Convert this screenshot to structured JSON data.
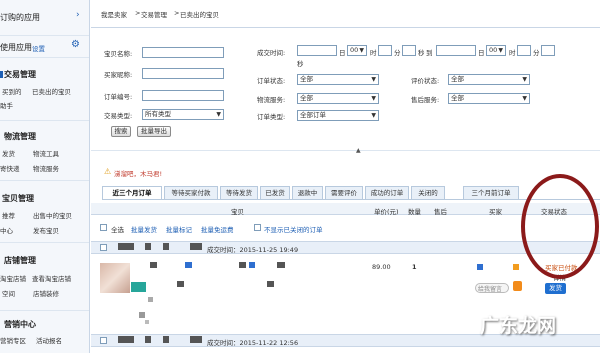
{
  "sidebar": {
    "top_link": "订购的应用",
    "my_apps": "使用应用",
    "settings": "设置",
    "sections": [
      {
        "title": "交易管理",
        "links": [
          "买到的",
          "已卖出的宝贝",
          "助手"
        ]
      },
      {
        "title": "物流管理",
        "links": [
          "发货",
          "物流工具",
          "寄快递",
          "物流服务"
        ]
      },
      {
        "title": "宝贝管理",
        "links": [
          "推荐",
          "出售中的宝贝",
          "中心",
          "发布宝贝"
        ]
      },
      {
        "title": "店铺管理",
        "links": [
          "淘宝店铺",
          "查看淘宝店铺",
          "空间",
          "店铺装修"
        ]
      },
      {
        "title": "营销中心",
        "links": [
          "营销专区",
          "活动报名"
        ]
      }
    ]
  },
  "breadcrumb": {
    "part1": "我是卖家",
    "sep": ">",
    "part2": "交易管理",
    "part3": "已卖出的宝贝"
  },
  "search_form": {
    "item_name_label": "宝贝名称:",
    "buyer_nick_label": "买家昵称:",
    "order_no_label": "订单编号:",
    "trade_type_label": "交易类型:",
    "trade_type_value": "所有类型",
    "deal_time_label": "成交时间:",
    "day": "日",
    "hour": "时",
    "minute": "分",
    "second": "秒",
    "to": "到",
    "hour_value": "00",
    "order_status_label": "订单状态:",
    "order_status_value": "全部",
    "logistics_label": "物流服务:",
    "logistics_value": "全部",
    "order_type_label": "订单类型:",
    "order_type_value": "全部订单",
    "review_status_label": "评价状态:",
    "review_status_value": "全部",
    "after_sale_label": "售后服务:",
    "after_sale_value": "全部",
    "search_button": "搜索",
    "export_button": "批量导出"
  },
  "notice": "涕溜吧，木马君!",
  "tabs": [
    "近三个月订单",
    "等待买家付款",
    "等待发货",
    "已发货",
    "退款中",
    "需要评价",
    "成功的订单",
    "关闭的",
    "三个月前订单"
  ],
  "table_header": {
    "item": "宝贝",
    "unit_price": "单价(元)",
    "quantity": "数量",
    "after_sale": "售后",
    "buyer": "买家",
    "status": "交易状态"
  },
  "bulk_actions": {
    "select_all": "全选",
    "batch_ship": "批量发货",
    "batch_mark": "批量标记",
    "batch_free_shipping": "批量免运费",
    "hide_closed": "不显示已关闭的订单"
  },
  "orders": [
    {
      "deal_time": "成交时间：2015-11-25 19:49",
      "price": "89.00",
      "quantity": "1",
      "status": "买家已付款",
      "detail": "详情",
      "ship_button": "发货",
      "memo_link": "给我留言"
    },
    {
      "deal_time": "成交时间：2015-11-22 12:56"
    }
  ],
  "watermark": "广东龙网",
  "colors": {
    "accent": "#1e5fb4",
    "circle": "#8b1a1a",
    "status": "#c84b0c",
    "ship_button": "#1f6fd0"
  }
}
